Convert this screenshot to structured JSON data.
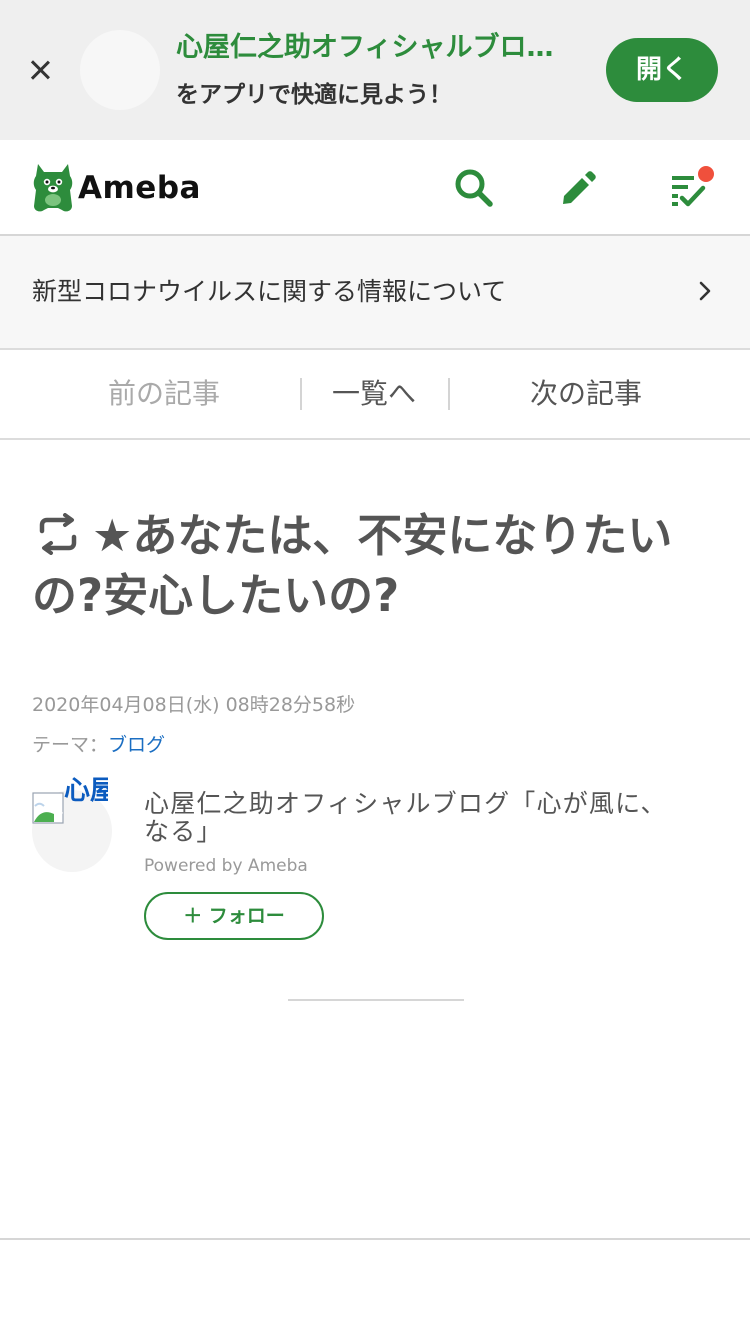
{
  "app_banner": {
    "title": "心屋仁之助オフィシャルブロ…",
    "subtitle": "をアプリで快適に見よう！",
    "open_label": "開く"
  },
  "header": {
    "logo_text": "Ameba",
    "icons": [
      "close-icon",
      "search-icon",
      "pencil-icon",
      "reader-list-icon"
    ],
    "accent_color": "#2d8c3c",
    "notification_color": "#f0503c"
  },
  "info_bar": {
    "text": "新型コロナウイルスに関する情報について"
  },
  "article_nav": {
    "prev": "前の記事",
    "list": "一覧へ",
    "next": "次の記事"
  },
  "article": {
    "title": "★あなたは、不安になりたいの?安心したいの?",
    "date": "2020年04月08日(水) 08時28分58秒",
    "theme_label": "テーマ：",
    "theme_value": "ブログ"
  },
  "author": {
    "avatar_alt": "心屋仁之助",
    "blog_name": "心屋仁之助オフィシャルブログ「心が風に、なる」",
    "powered_by": "Powered by Ameba",
    "follow_label": "＋ フォロー"
  }
}
